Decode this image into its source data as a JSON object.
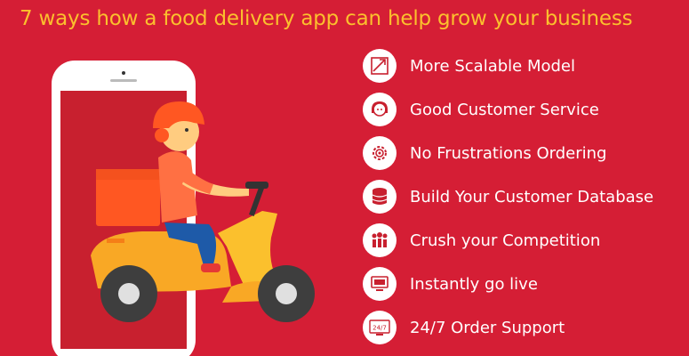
{
  "title": "7 ways how a food delivery app can help grow your business",
  "colors": {
    "background": "#d51e35",
    "title": "#fbc02d",
    "accent": "#c8202f",
    "scooter": "#f9a825",
    "helmet": "#ff5722",
    "box": "#ff5722"
  },
  "features": [
    {
      "label": "More Scalable Model",
      "icon": "chart-icon"
    },
    {
      "label": "Good Customer Service",
      "icon": "support-agent-icon"
    },
    {
      "label": "No Frustrations Ordering",
      "icon": "gear-icon"
    },
    {
      "label": "Build Your Customer Database",
      "icon": "database-icon"
    },
    {
      "label": "Crush your Competition",
      "icon": "team-icon"
    },
    {
      "label": "Instantly go live",
      "icon": "monitor-icon"
    },
    {
      "label": "24/7 Order Support",
      "icon": "clock-24-7-icon",
      "icon_text": "24/7"
    }
  ]
}
